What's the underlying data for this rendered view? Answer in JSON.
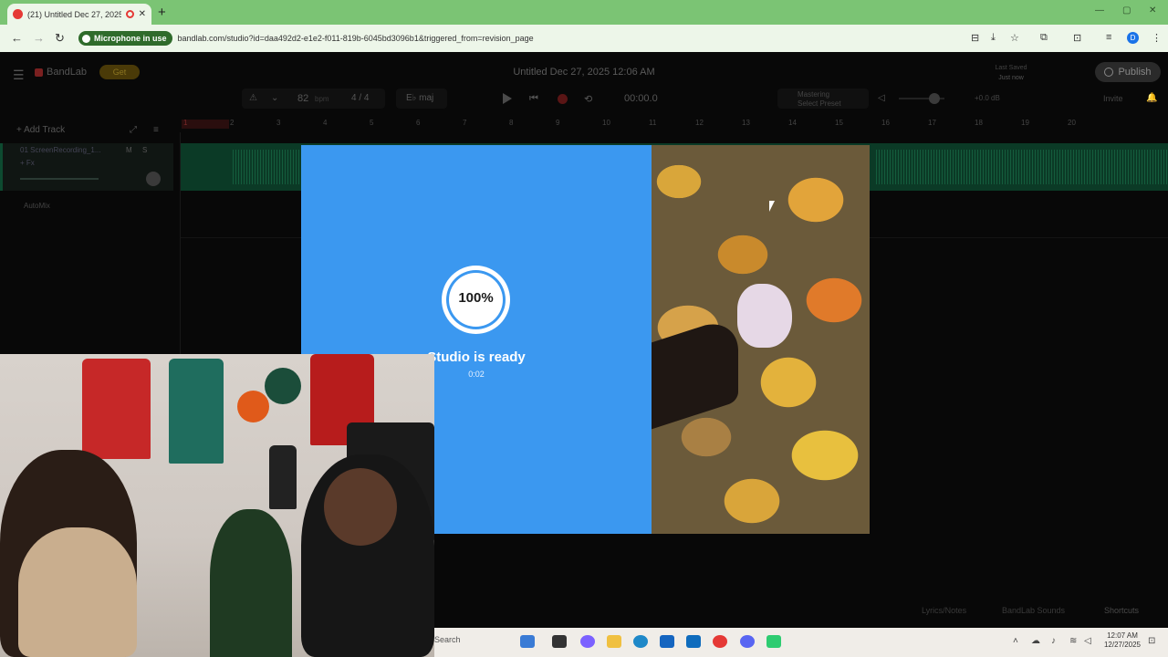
{
  "browser": {
    "tab_title": "(21) Untitled Dec 27, 2025",
    "tab_close": "✕",
    "new_tab": "+",
    "mic_chip": "Microphone in use",
    "url": "bandlab.com/studio?id=daa492d2-e1e2-f011-819b-6045bd3096b1&triggered_from=revision_page",
    "profile_initial": "D",
    "window_controls": [
      "—",
      "▢",
      "✕"
    ],
    "nav": [
      "←",
      "→",
      "↻"
    ],
    "toolbar_icons": [
      "⊟",
      "⤓",
      "☆",
      "⧉",
      "⊡",
      "≡",
      "⋮"
    ]
  },
  "app": {
    "logo_text": "BandLab",
    "get_button": "Get",
    "project_title": "Untitled Dec 27, 2025 12:06 AM",
    "saved_label": "Last Saved",
    "saved_value": "Just now",
    "publish": "Publish",
    "tempo": "82",
    "tempo_unit": "bpm",
    "time_signature": "4 / 4",
    "key": "E♭ maj",
    "time": "00:00.0",
    "mastering_label": "Mastering",
    "mastering_sub": "Select Preset",
    "volume_db": "+0.0 dB",
    "invite": "Invite",
    "add_track": "Add Track",
    "ruler": [
      "1",
      "2",
      "3",
      "4",
      "5",
      "6",
      "7",
      "8",
      "9",
      "10",
      "11",
      "12",
      "13",
      "14",
      "15",
      "16",
      "17",
      "18",
      "19",
      "20"
    ],
    "track_name": "01 ScreenRecording_1...",
    "track_fx": "+ Fx",
    "track_m": "M",
    "track_s": "S",
    "automix": "AutoMix",
    "bottom": [
      "Lyrics/Notes",
      "BandLab Sounds",
      "Shortcuts"
    ]
  },
  "loader": {
    "percent": "100%",
    "percent_value": 100,
    "status": "Studio is ready",
    "elapsed": "0:02"
  },
  "taskbar": {
    "search": "Search",
    "clock_time": "12:07 AM",
    "clock_date": "12/27/2025"
  },
  "colors": {
    "loader_blue": "#3b98f0",
    "browser_green": "#7bc474",
    "track_green": "#0b3a26"
  }
}
